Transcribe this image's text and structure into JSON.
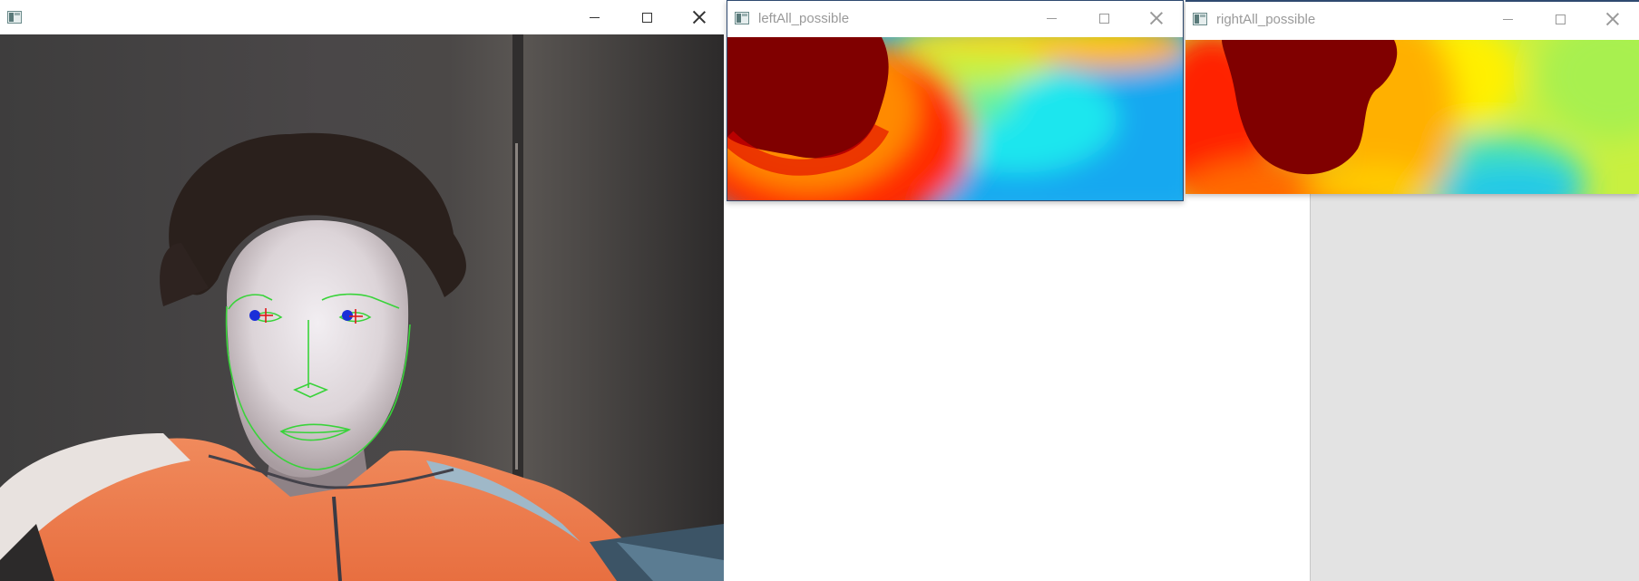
{
  "webcam_window": {
    "title": "",
    "icon": "app-window-icon",
    "controls": {
      "minimize": "minimize-icon",
      "maximize": "maximize-icon",
      "close": "close-icon"
    }
  },
  "left_window": {
    "title": "leftAll_possible",
    "icon": "app-window-icon",
    "controls": {
      "minimize": "minimize-icon",
      "maximize": "maximize-icon",
      "close": "close-icon"
    }
  },
  "right_window": {
    "title": "rightAll_possible",
    "icon": "app-window-icon",
    "controls": {
      "minimize": "minimize-icon",
      "maximize": "maximize-icon",
      "close": "close-icon"
    }
  },
  "colors": {
    "title_text": "#9a9a9a",
    "landmark_green": "#39d33a",
    "pupil_blue": "#1a2fd8",
    "gaze_red": "#e01818",
    "active_border": "#2f4a70"
  }
}
